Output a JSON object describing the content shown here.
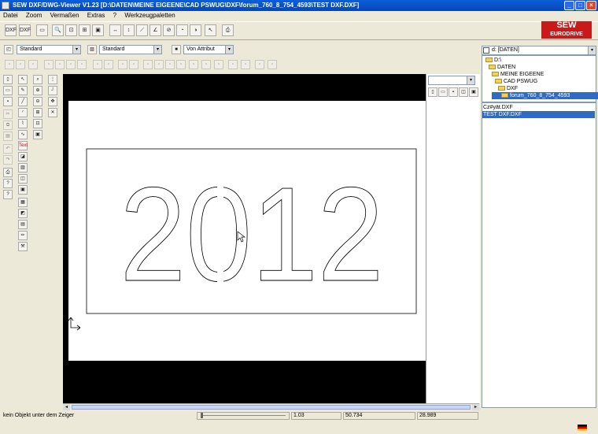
{
  "window": {
    "title": "SEW DXF/DWG-Viewer V1.23 [D:\\DATEN\\MEINE EIGEENE\\CAD PSWUG\\DXF\\forum_760_8_754_4593\\TEST DXF.DXF]",
    "min": "_",
    "max": "□",
    "close": "×"
  },
  "menu": [
    "Datei",
    "Zoom",
    "Vermaßen",
    "Extras",
    "?",
    "Werkzeugpaletten"
  ],
  "toolbar": {
    "dxf_label": "DXF",
    "dwf_label": "DXF"
  },
  "logo": {
    "line1": "SEW",
    "line2": "EURODRIVE"
  },
  "layers": {
    "layer_value": "Standard",
    "linetype_value": "Standard",
    "color_value": "Von Attribut",
    "arrow": "▾"
  },
  "drawing": {
    "text": "2012"
  },
  "left_tool_labels": {
    "text_tool": "Text"
  },
  "right_panel": {
    "combo_value": ""
  },
  "file_browser": {
    "drive": "d: [DATEN]",
    "tree": [
      "D:\\",
      "DATEN",
      "MEINE EIGEENE",
      "CAD PSWUG",
      "DXF",
      "forum_760_8_754_4593"
    ],
    "files": [
      "Cz#yät.DXF",
      "TEST DXF.DXF"
    ]
  },
  "status": {
    "message": "kein Objekt unter dem Zeiger",
    "zoom": "1.03",
    "x": "50.734",
    "y": "28.989"
  }
}
